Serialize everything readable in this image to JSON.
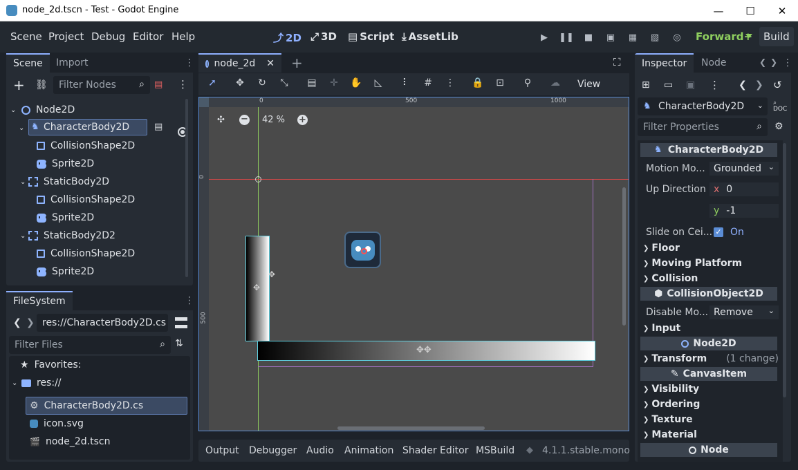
{
  "window": {
    "title": "node_2d.tscn - Test - Godot Engine",
    "minimize": "—",
    "maximize": "☐",
    "close": "✕"
  },
  "menu": [
    "Scene",
    "Project",
    "Debug",
    "Editor",
    "Help"
  ],
  "modes": [
    {
      "label": "2D",
      "icon": "2d-icon"
    },
    {
      "label": "3D",
      "icon": "3d-icon"
    },
    {
      "label": "Script",
      "icon": "script-icon"
    },
    {
      "label": "AssetLib",
      "icon": "assetlib-icon"
    }
  ],
  "renderer": "Forward+",
  "build_label": "Build",
  "scene_dock": {
    "tabs": [
      "Scene",
      "Import"
    ],
    "filter_placeholder": "Filter Nodes",
    "nodes": [
      {
        "label": "Node2D",
        "icon": "node2d-icon",
        "depth": 0
      },
      {
        "label": "CharacterBody2D",
        "icon": "characterbody2d-icon",
        "depth": 1
      },
      {
        "label": "CollisionShape2D",
        "icon": "collisionshape2d-icon",
        "depth": 2
      },
      {
        "label": "Sprite2D",
        "icon": "sprite2d-icon",
        "depth": 2
      },
      {
        "label": "StaticBody2D",
        "icon": "staticbody2d-icon",
        "depth": 1
      },
      {
        "label": "CollisionShape2D",
        "icon": "collisionshape2d-icon",
        "depth": 2
      },
      {
        "label": "Sprite2D",
        "icon": "sprite2d-icon",
        "depth": 2
      },
      {
        "label": "StaticBody2D2",
        "icon": "staticbody2d-icon",
        "depth": 1
      },
      {
        "label": "CollisionShape2D",
        "icon": "collisionshape2d-icon",
        "depth": 2
      },
      {
        "label": "Sprite2D",
        "icon": "sprite2d-icon",
        "depth": 2
      }
    ]
  },
  "filesystem": {
    "tab": "FileSystem",
    "path": "res://CharacterBody2D.cs",
    "filter_placeholder": "Filter Files",
    "favorites": "Favorites:",
    "root": "res://",
    "files": [
      "CharacterBody2D.cs",
      "icon.svg",
      "node_2d.tscn"
    ]
  },
  "editor_tab": "node_2d",
  "toolbar_view": "View",
  "viewport": {
    "zoom": "42 %",
    "ruler_top": [
      "0",
      "500",
      "1000"
    ],
    "ruler_left": [
      "0",
      "500"
    ]
  },
  "bottom_tabs": [
    "Output",
    "Debugger",
    "Audio",
    "Animation",
    "Shader Editor",
    "MSBuild"
  ],
  "version": "4.1.1.stable.mono",
  "inspector": {
    "tabs": [
      "Inspector",
      "Node"
    ],
    "node_type": "CharacterBody2D",
    "filter_placeholder": "Filter Properties",
    "header": "CharacterBody2D",
    "motion_mode_label": "Motion Mo...",
    "motion_mode_value": "Grounded",
    "up_direction_label": "Up Direction",
    "up_x_label": "x",
    "up_x": "0",
    "up_y_label": "y",
    "up_y": "-1",
    "slide_label": "Slide on Cei...",
    "slide_value": "On",
    "sections1": [
      "Floor",
      "Moving Platform",
      "Collision"
    ],
    "collision_header": "CollisionObject2D",
    "disable_mode_label": "Disable Mo...",
    "disable_mode_value": "Remove",
    "input_section": "Input",
    "node2d_header": "Node2D",
    "transform_section": "Transform",
    "transform_note": "(1 change)",
    "canvas_header": "CanvasItem",
    "sections2": [
      "Visibility",
      "Ordering",
      "Texture",
      "Material"
    ],
    "node_header": "Node"
  },
  "colors": {
    "accent": "#8fb0ff",
    "renderer": "#8fcf5f",
    "panel": "#262c34",
    "background": "#1d2229"
  }
}
